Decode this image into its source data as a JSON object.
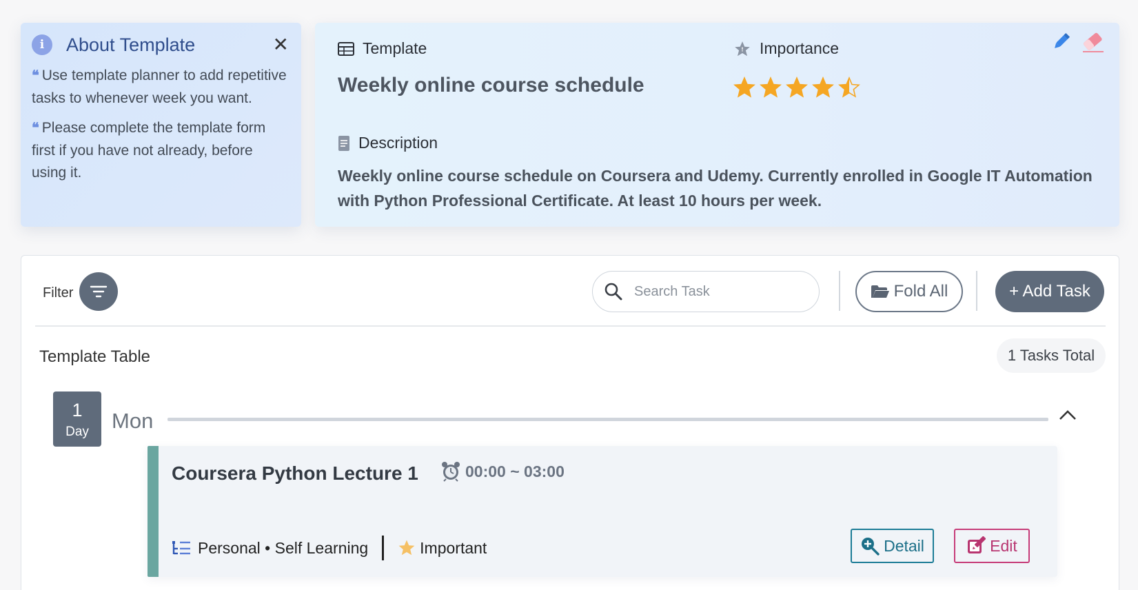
{
  "about": {
    "title": "About Template",
    "paragraphs": [
      "Use template planner to add repetitive tasks to whenever week you want.",
      "Please complete the template form first if you have not already, before using it."
    ]
  },
  "template": {
    "label": "Template",
    "name": "Weekly online course schedule",
    "importance_label": "Importance",
    "importance_rating": 4.5,
    "importance_max": 5,
    "description_label": "Description",
    "description": "Weekly online course schedule on Coursera and Udemy. Currently enrolled in Google IT Automation with Python Professional Certificate. At least 10 hours per week."
  },
  "toolbar": {
    "filter_label": "Filter",
    "search_placeholder": "Search Task",
    "fold_label": "Fold All",
    "add_label": "+ Add Task"
  },
  "table": {
    "title": "Template Table",
    "tasks_total": "1 Tasks Total",
    "days": [
      {
        "number": "1",
        "unit": "Day",
        "name": "Mon",
        "tasks": [
          {
            "title": "Coursera Python Lecture 1",
            "time": "00:00 ~ 03:00",
            "category": "Personal • Self Learning",
            "importance": "Important",
            "detail_label": "Detail",
            "edit_label": "Edit",
            "accent_color": "#6aa6a0"
          }
        ]
      }
    ]
  },
  "colors": {
    "primary_gray": "#5f6b7b",
    "star": "#f5a623",
    "detail": "#1b7c96",
    "edit": "#c63b78"
  }
}
